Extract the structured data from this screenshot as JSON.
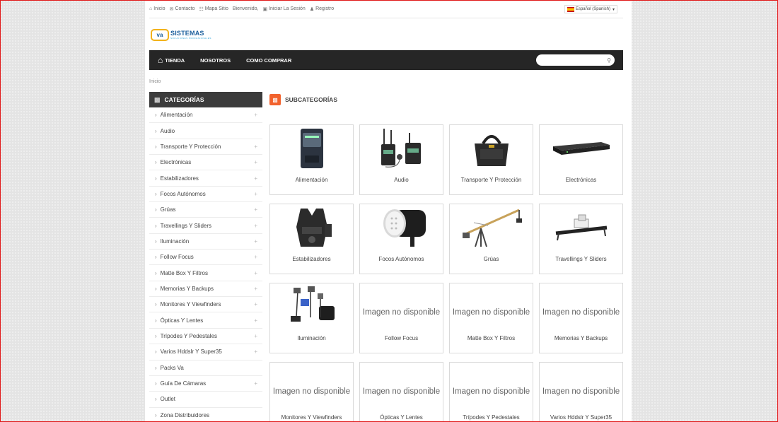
{
  "topbar": {
    "inicio": "Inicio",
    "contacto": "Contacto",
    "mapa": "Mapa Sitio",
    "bienvenido": "Bienvenido,",
    "login": "Iniciar La Sesión",
    "registro": "Registro",
    "language": "Español (Spanish)"
  },
  "logo": {
    "badge": "va",
    "name": "SISTEMAS",
    "tagline": "SOLUCIONES PROFESIONALES"
  },
  "nav": {
    "items": [
      "TIENDA",
      "NOSOTROS",
      "COMO COMPRAR"
    ],
    "search_placeholder": ""
  },
  "breadcrumb": "Inicio",
  "sidebar": {
    "title": "CATEGORÍAS",
    "items": [
      {
        "label": "Alimentación",
        "plus": true
      },
      {
        "label": "Audio",
        "plus": false
      },
      {
        "label": "Transporte Y Protección",
        "plus": true
      },
      {
        "label": "Electrónicas",
        "plus": true
      },
      {
        "label": "Estabilizadores",
        "plus": true
      },
      {
        "label": "Focos Autónomos",
        "plus": true
      },
      {
        "label": "Grúas",
        "plus": true
      },
      {
        "label": "Travellings Y Sliders",
        "plus": true
      },
      {
        "label": "Iluminación",
        "plus": true
      },
      {
        "label": "Follow Focus",
        "plus": true
      },
      {
        "label": "Matte Box Y Filtros",
        "plus": true
      },
      {
        "label": "Memorias Y Backups",
        "plus": true
      },
      {
        "label": "Monitores Y Viewfinders",
        "plus": true
      },
      {
        "label": "Ópticas Y Lentes",
        "plus": true
      },
      {
        "label": "Trípodes Y Pedestales",
        "plus": true
      },
      {
        "label": "Varios Hddslr Y Super35",
        "plus": true
      },
      {
        "label": "Packs Va",
        "plus": false
      },
      {
        "label": "Guía De Cámaras",
        "plus": true
      },
      {
        "label": "Outlet",
        "plus": false
      },
      {
        "label": "Zona Distribuidores",
        "plus": false
      }
    ]
  },
  "main": {
    "title": "SUBCATEGORÍAS",
    "no_image_text": "Imagen no disponible",
    "cards": [
      {
        "label": "Alimentación",
        "image": "battery"
      },
      {
        "label": "Audio",
        "image": "audio"
      },
      {
        "label": "Transporte Y Protección",
        "image": "bag"
      },
      {
        "label": "Electrónicas",
        "image": "rack"
      },
      {
        "label": "Estabilizadores",
        "image": "vest"
      },
      {
        "label": "Focos Autónomos",
        "image": "led"
      },
      {
        "label": "Grúas",
        "image": "crane"
      },
      {
        "label": "Travellings Y Sliders",
        "image": "slider"
      },
      {
        "label": "Iluminación",
        "image": "lights"
      },
      {
        "label": "Follow Focus",
        "image": "none"
      },
      {
        "label": "Matte Box Y Filtros",
        "image": "none"
      },
      {
        "label": "Memorias Y Backups",
        "image": "none"
      },
      {
        "label": "Monitores Y Viewfinders",
        "image": "none"
      },
      {
        "label": "Ópticas Y Lentes",
        "image": "none"
      },
      {
        "label": "Trípodes Y Pedestales",
        "image": "none"
      },
      {
        "label": "Varios Hddslr Y Super35",
        "image": "none"
      }
    ]
  }
}
